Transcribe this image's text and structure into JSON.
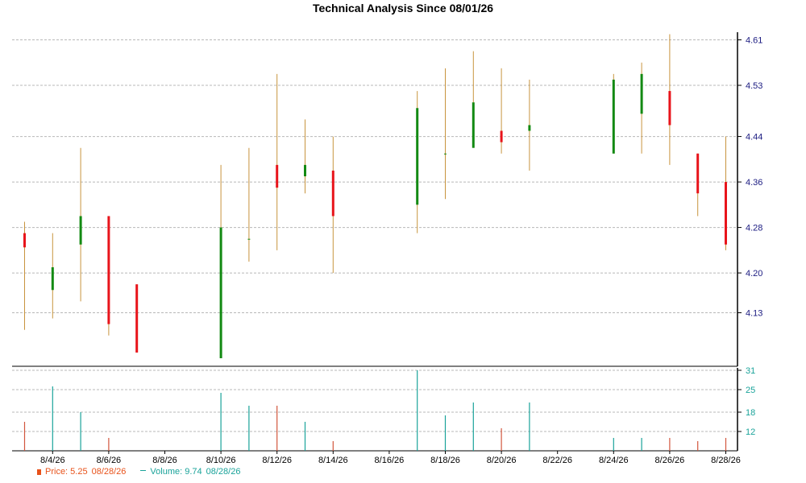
{
  "chart_data": {
    "type": "candlestick",
    "title": "Technical Analysis Since 08/01/26",
    "x_tick_labels": [
      "8/4/26",
      "8/6/26",
      "8/8/26",
      "8/10/26",
      "8/12/26",
      "8/14/26",
      "8/16/26",
      "8/18/26",
      "8/20/26",
      "8/22/26",
      "8/24/26",
      "8/26/26",
      "8/28/26"
    ],
    "price_axis": {
      "ticks": [
        4.13,
        4.2,
        4.28,
        4.36,
        4.44,
        4.53,
        4.61
      ],
      "range": [
        4.06,
        4.61
      ]
    },
    "volume_axis": {
      "ticks": [
        12,
        18,
        25,
        31
      ],
      "range": [
        6,
        31
      ]
    },
    "candles": [
      {
        "day": 3,
        "open": 4.27,
        "high": 4.29,
        "low": 4.1,
        "close": 4.245,
        "volume": 15
      },
      {
        "day": 4,
        "open": 4.17,
        "high": 4.27,
        "low": 4.12,
        "close": 4.21,
        "volume": 26
      },
      {
        "day": 5,
        "open": 4.25,
        "high": 4.42,
        "low": 4.15,
        "close": 4.3,
        "volume": 18
      },
      {
        "day": 6,
        "open": 4.3,
        "high": 4.3,
        "low": 4.09,
        "close": 4.11,
        "volume": 10
      },
      {
        "day": 7,
        "open": 4.18,
        "high": 4.18,
        "low": 4.06,
        "close": 4.06,
        "volume": 0
      },
      {
        "day": 10,
        "open": 4.05,
        "high": 4.39,
        "low": 4.05,
        "close": 4.28,
        "volume": 24
      },
      {
        "day": 11,
        "open": 4.26,
        "high": 4.42,
        "low": 4.22,
        "close": 4.26,
        "volume": 20
      },
      {
        "day": 12,
        "open": 4.39,
        "high": 4.55,
        "low": 4.24,
        "close": 4.35,
        "volume": 20
      },
      {
        "day": 13,
        "open": 4.37,
        "high": 4.47,
        "low": 4.34,
        "close": 4.39,
        "volume": 15
      },
      {
        "day": 14,
        "open": 4.38,
        "high": 4.44,
        "low": 4.2,
        "close": 4.3,
        "volume": 9
      },
      {
        "day": 17,
        "open": 4.32,
        "high": 4.52,
        "low": 4.27,
        "close": 4.49,
        "volume": 31
      },
      {
        "day": 18,
        "open": 4.41,
        "high": 4.56,
        "low": 4.33,
        "close": 4.41,
        "volume": 17
      },
      {
        "day": 19,
        "open": 4.42,
        "high": 4.59,
        "low": 4.42,
        "close": 4.5,
        "volume": 21
      },
      {
        "day": 20,
        "open": 4.45,
        "high": 4.56,
        "low": 4.41,
        "close": 4.43,
        "volume": 13
      },
      {
        "day": 21,
        "open": 4.45,
        "high": 4.54,
        "low": 4.38,
        "close": 4.46,
        "volume": 21
      },
      {
        "day": 24,
        "open": 4.41,
        "high": 4.55,
        "low": 4.41,
        "close": 4.54,
        "volume": 10
      },
      {
        "day": 25,
        "open": 4.48,
        "high": 4.57,
        "low": 4.41,
        "close": 4.55,
        "volume": 10
      },
      {
        "day": 26,
        "open": 4.52,
        "high": 4.62,
        "low": 4.39,
        "close": 4.46,
        "volume": 10
      },
      {
        "day": 27,
        "open": 4.41,
        "high": 4.41,
        "low": 4.3,
        "close": 4.34,
        "volume": 9
      },
      {
        "day": 28,
        "open": 4.36,
        "high": 4.44,
        "low": 4.24,
        "close": 4.25,
        "volume": 10
      }
    ],
    "colors": {
      "up": "#138a13",
      "down": "#e8141b",
      "wick": "#c8943e",
      "volume_up": "#1aa39a",
      "volume_down": "#d2563d",
      "grid": "#b8b8b8",
      "price_tick": "#1a1a80",
      "volume_tick": "#1aa39a"
    },
    "grid": true
  },
  "legend": {
    "price_label": "Price: 5.25",
    "price_date": "08/28/26",
    "volume_label": "Volume: 9.74",
    "volume_date": "08/28/26",
    "price_color": "#e8521a",
    "volume_color": "#1aa39a"
  }
}
